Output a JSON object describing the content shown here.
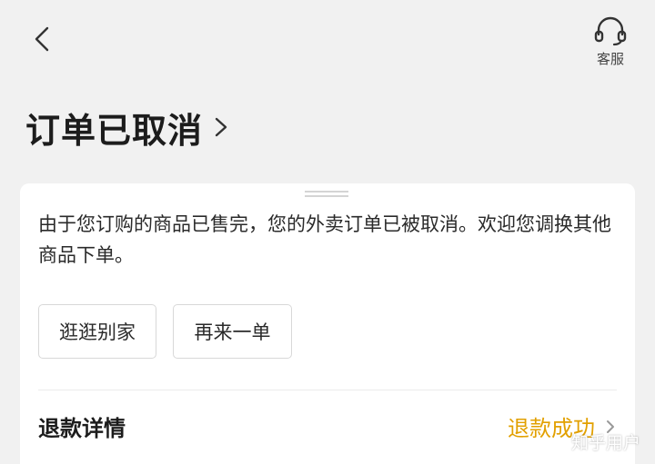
{
  "header": {
    "back_icon": "chevron-left-icon",
    "customer_service_icon": "headset-icon",
    "customer_service_label": "客服"
  },
  "order": {
    "status_title": "订单已取消",
    "message": "由于您订购的商品已售完，您的外卖订单已被取消。欢迎您调换其他商品下单。",
    "buttons": {
      "browse_other": "逛逛别家",
      "reorder": "再来一单"
    }
  },
  "refund": {
    "label": "退款详情",
    "status": "退款成功"
  },
  "watermark": "知乎用户",
  "colors": {
    "page_background": "#f1f1f1",
    "card_background": "#ffffff",
    "refund_status": "#e2a000"
  }
}
